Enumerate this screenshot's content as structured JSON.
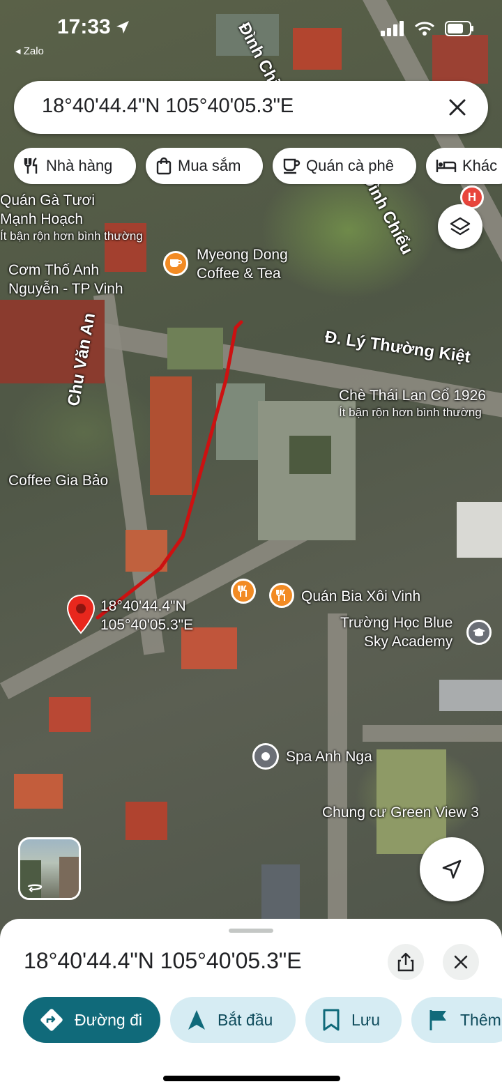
{
  "status_bar": {
    "time": "17:33",
    "back_app": "◂ Zalo"
  },
  "search": {
    "value": "18°40'44.4\"N 105°40'05.3\"E"
  },
  "chips": [
    {
      "label": "Nhà hàng",
      "icon": "restaurant-icon"
    },
    {
      "label": "Mua sắm",
      "icon": "shopping-bag-icon"
    },
    {
      "label": "Quán cà phê",
      "icon": "coffee-icon"
    },
    {
      "label": "Khác",
      "icon": "bed-icon"
    }
  ],
  "map_labels": {
    "quan_ga_1": "Quán Gà Tươi",
    "quan_ga_2": "Mạnh Hoạch",
    "quan_ga_busy": "Ít bận rộn hơn bình thường",
    "com_tho_1": "Cơm Thố Anh",
    "com_tho_2": "Nguyễn - TP Vinh",
    "myeong_1": "Myeong Dong",
    "myeong_2": "Coffee & Tea",
    "street_dinh_chieu_1": "Đình Chiểu",
    "street_dinh_chieu_2": "Đình Chiểu",
    "street_ly_thuong_kiet": "Đ. Lý Thường Kiệt",
    "street_chu_van_an": "Chu Văn An",
    "che_thai": "Chè Thái Lan Cổ 1926",
    "che_thai_busy": "Ít bận rộn hơn bình thường",
    "coffee_gia_bao": "Coffee Gia Bảo",
    "pin_1": "18°40'44.4\"N",
    "pin_2": "105°40'05.3\"E",
    "quan_bia": "Quán Bia Xôi Vinh",
    "truong_1": "Trường Học Blue",
    "truong_2": "Sky Academy",
    "spa": "Spa Anh Nga",
    "chung_cu": "Chung cư Green View 3"
  },
  "colors": {
    "route": "#cc1111",
    "pin": "#e8271d",
    "poi_food": "#f28b24",
    "poi_school": "#6b6f76",
    "accent": "#106a7a",
    "action_bg": "#d6ecf3"
  },
  "sheet": {
    "title": "18°40'44.4\"N 105°40'05.3\"E",
    "actions": [
      {
        "label": "Đường đi",
        "icon": "directions-icon",
        "primary": true
      },
      {
        "label": "Bắt đầu",
        "icon": "navigation-arrow-icon"
      },
      {
        "label": "Lưu",
        "icon": "bookmark-icon"
      },
      {
        "label": "Thêm",
        "icon": "flag-icon"
      }
    ]
  }
}
